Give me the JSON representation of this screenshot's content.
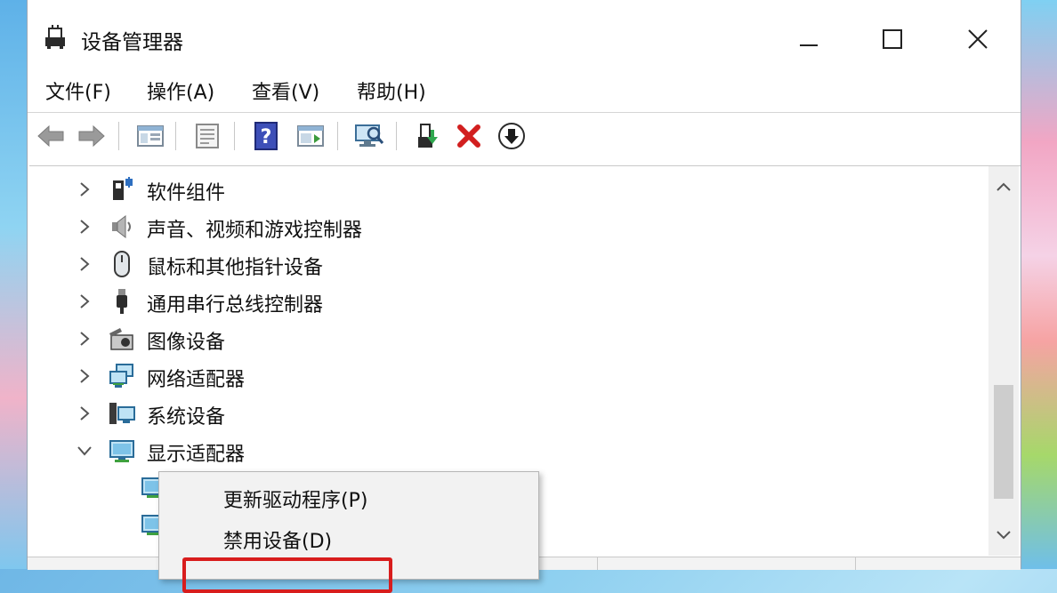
{
  "window": {
    "title": "设备管理器",
    "controls": {
      "minimize": "—",
      "maximize": "☐",
      "close": "✕"
    }
  },
  "menubar": [
    {
      "label": "文件(F)"
    },
    {
      "label": "操作(A)"
    },
    {
      "label": "查看(V)"
    },
    {
      "label": "帮助(H)"
    }
  ],
  "toolbar": {
    "buttons": [
      "back-icon",
      "forward-icon",
      "show-hide-console-tree-icon",
      "properties-icon",
      "help-icon",
      "action-pane-icon",
      "scan-hardware-icon",
      "update-driver-icon",
      "uninstall-icon",
      "enable-device-icon"
    ]
  },
  "tree": {
    "items": [
      {
        "label": "软件组件",
        "expanded": false,
        "icon": "software-component-icon"
      },
      {
        "label": "声音、视频和游戏控制器",
        "expanded": false,
        "icon": "speaker-icon"
      },
      {
        "label": "鼠标和其他指针设备",
        "expanded": false,
        "icon": "mouse-icon"
      },
      {
        "label": "通用串行总线控制器",
        "expanded": false,
        "icon": "usb-icon"
      },
      {
        "label": "图像设备",
        "expanded": false,
        "icon": "camera-icon"
      },
      {
        "label": "网络适配器",
        "expanded": false,
        "icon": "network-adapter-icon"
      },
      {
        "label": "系统设备",
        "expanded": false,
        "icon": "system-device-icon"
      },
      {
        "label": "显示适配器",
        "expanded": true,
        "icon": "display-adapter-icon"
      }
    ]
  },
  "context_menu": {
    "items": [
      {
        "label": "更新驱动程序(P)"
      },
      {
        "label": "禁用设备(D)"
      }
    ]
  },
  "colors": {
    "highlight_border": "#d81d1d"
  }
}
